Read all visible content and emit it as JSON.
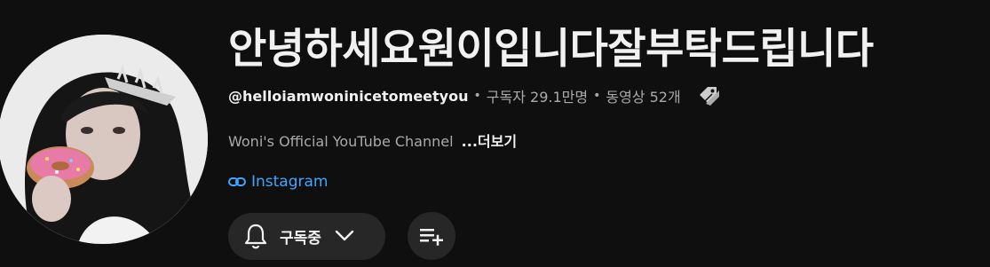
{
  "channel": {
    "title": "안녕하세요원이입니다잘부탁드립니다",
    "handle": "@helloiamwoninicetomeetyou",
    "subscribers": "구독자 29.1만명",
    "videos": "동영상 52개",
    "separator": "•",
    "description": "Woni's Official YouTube Channel",
    "more_label": "...더보기",
    "link_label": "Instagram"
  },
  "actions": {
    "subscribe_label": "구독중"
  },
  "icons": {
    "tag": "tag-icon",
    "link": "link-icon",
    "bell": "bell-icon",
    "chevron": "chevron-down-icon",
    "playlist_add": "playlist-add-icon"
  },
  "colors": {
    "background": "#0f0f0f",
    "text_primary": "#f1f1f1",
    "text_secondary": "#aaaaaa",
    "link": "#3ea6ff",
    "button_bg": "#272727"
  }
}
